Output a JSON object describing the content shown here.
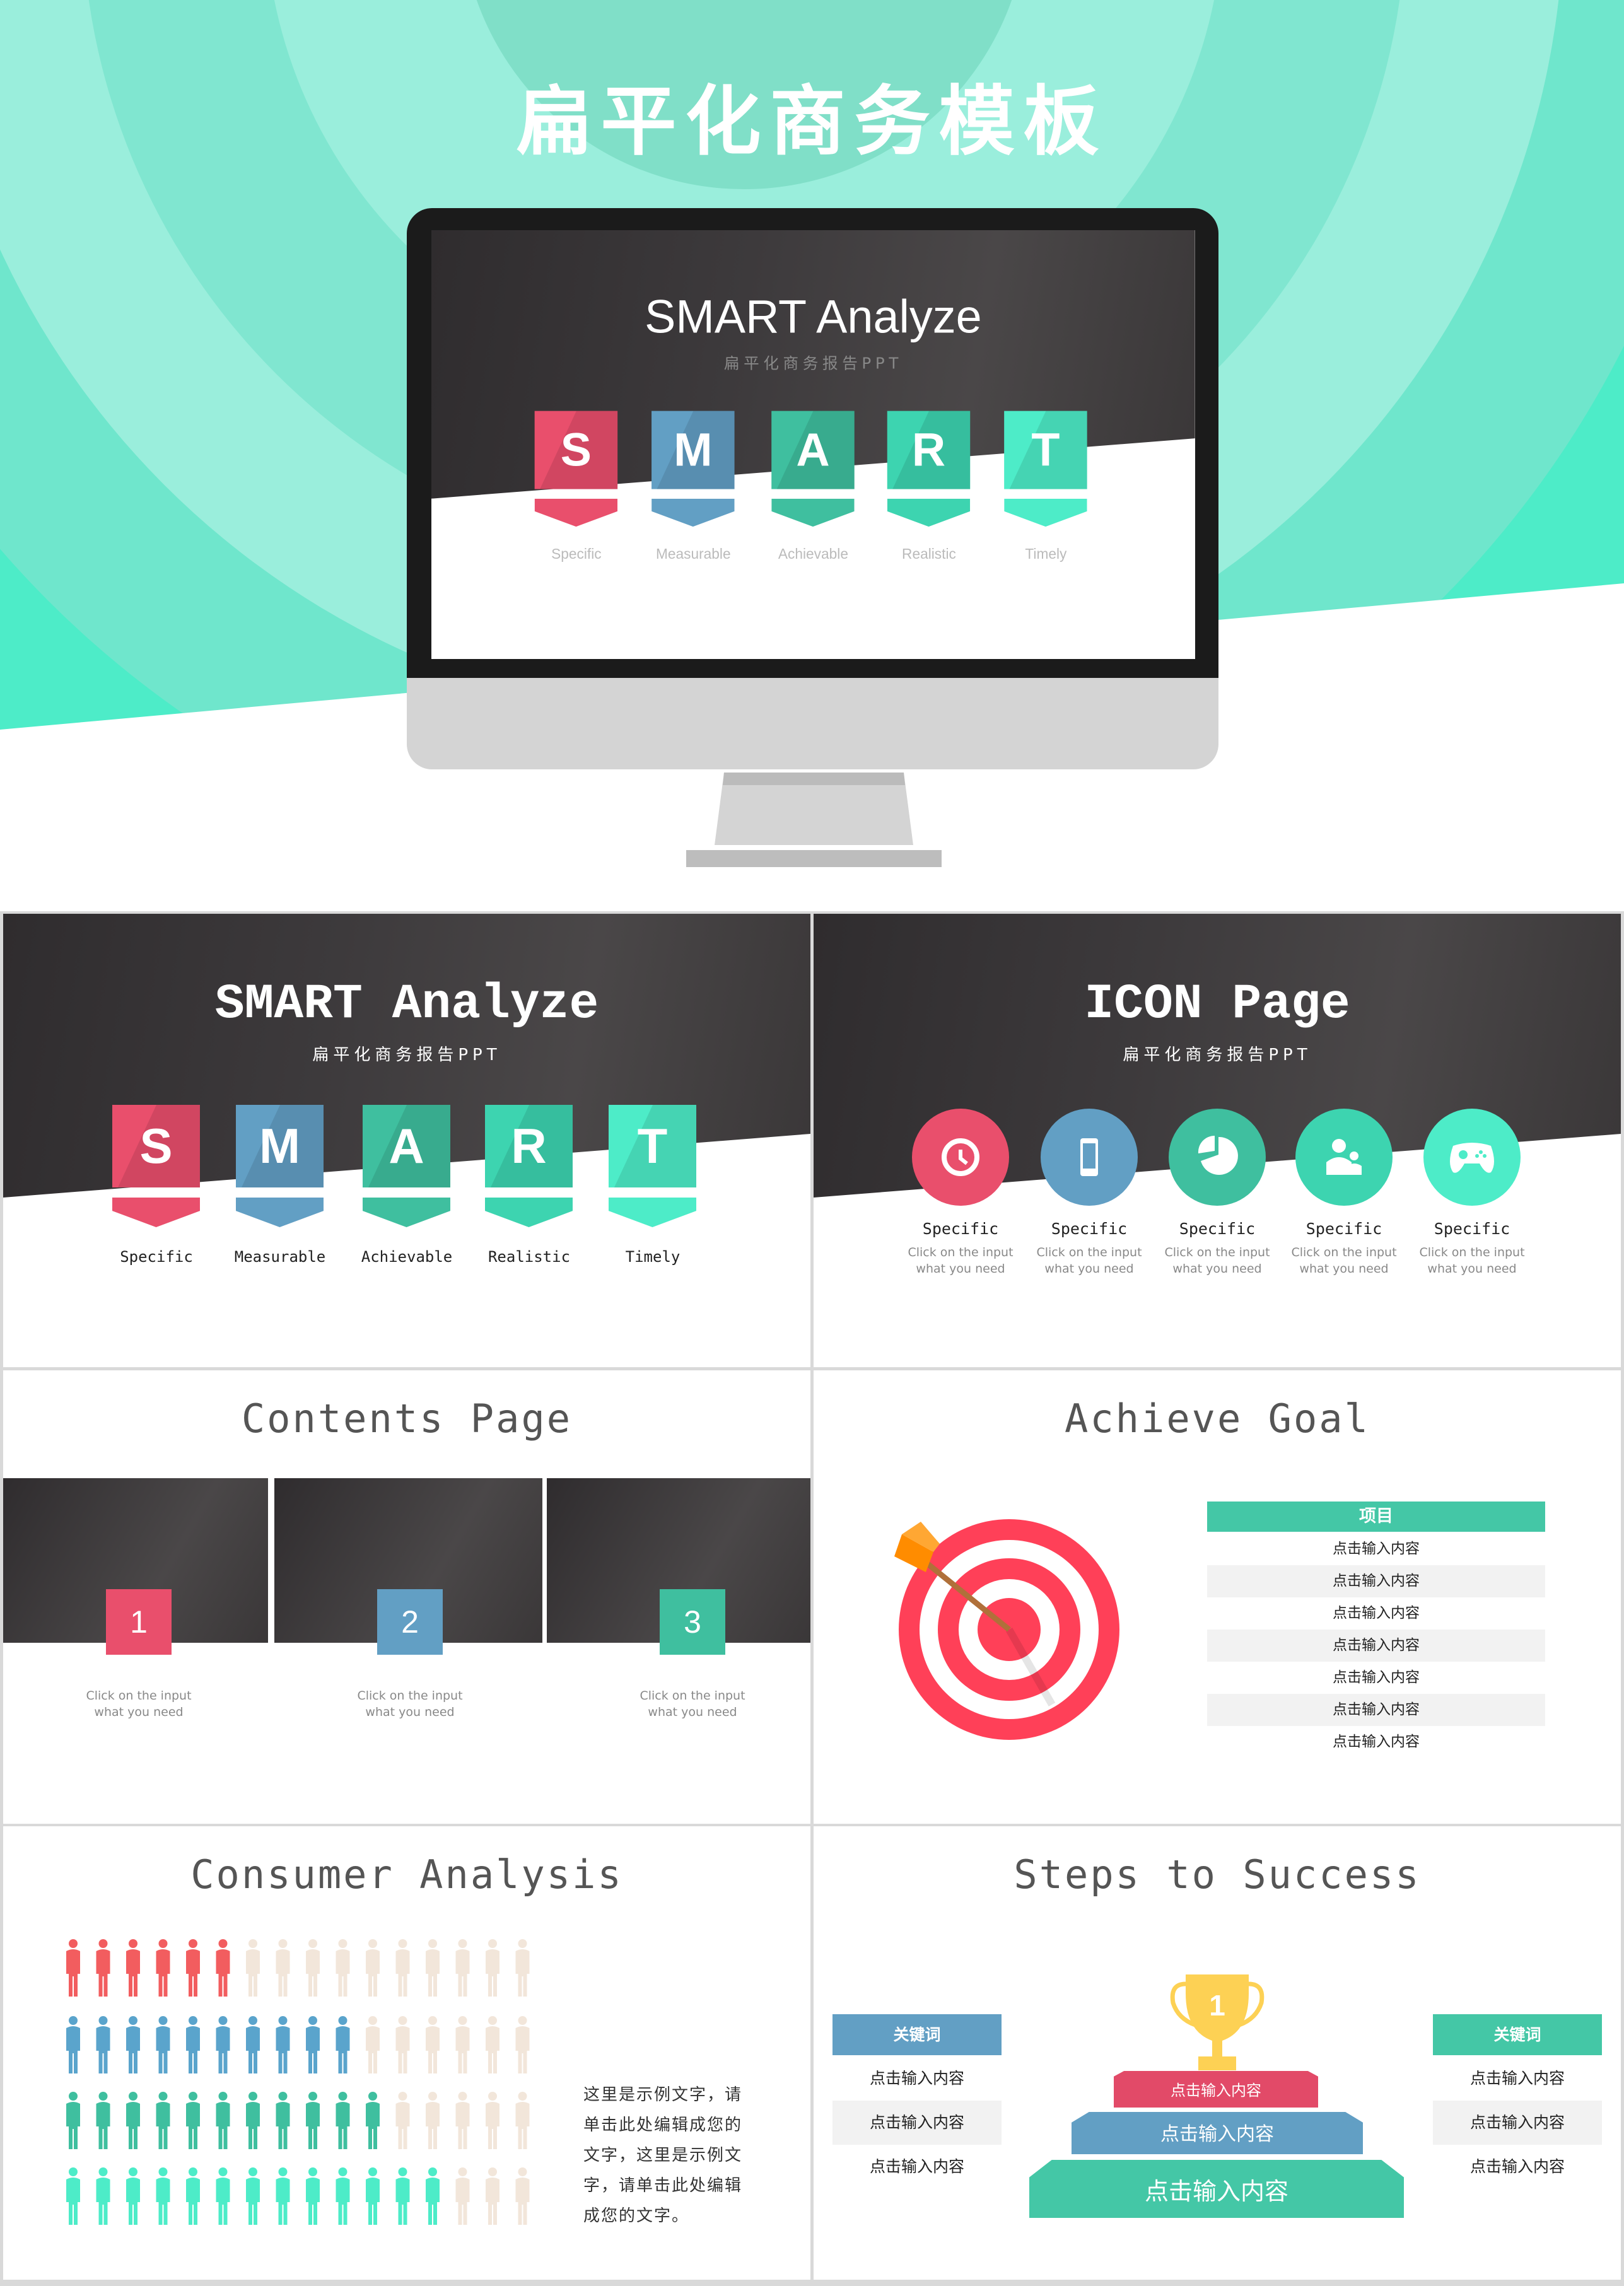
{
  "hero": {
    "title": "扁平化商务模板"
  },
  "colors": {
    "red": "#e94f6c",
    "blue": "#629fc4",
    "green": "#3fbf9f",
    "teal": "#3dd4b0",
    "mint": "#4decc8",
    "people_empty": "#f2e6da",
    "people_red": "#f25d5f",
    "people_blue": "#5aa4cc",
    "target_red": "#ff4058",
    "trophy": "#fdd154"
  },
  "monitor_screen": {
    "title": "SMART Analyze",
    "subtitle": "扁平化商务报告PPT",
    "letters": [
      {
        "letter": "S",
        "label": "Specific"
      },
      {
        "letter": "M",
        "label": "Measurable"
      },
      {
        "letter": "A",
        "label": "Achievable"
      },
      {
        "letter": "R",
        "label": "Realistic"
      },
      {
        "letter": "T",
        "label": "Timely"
      }
    ]
  },
  "smart": {
    "title": "SMART Analyze",
    "subtitle": "扁平化商务报告PPT",
    "letters": [
      {
        "letter": "S",
        "label": "Specific"
      },
      {
        "letter": "M",
        "label": "Measurable"
      },
      {
        "letter": "A",
        "label": "Achievable"
      },
      {
        "letter": "R",
        "label": "Realistic"
      },
      {
        "letter": "T",
        "label": "Timely"
      }
    ]
  },
  "icon_page": {
    "title": "ICON Page",
    "subtitle": "扁平化商务报告PPT",
    "items": [
      {
        "icon": "clock-icon",
        "label": "Specific",
        "line1": "Click on the input",
        "line2": "what you need"
      },
      {
        "icon": "smartphone-icon",
        "label": "Specific",
        "line1": "Click on the input",
        "line2": "what you need"
      },
      {
        "icon": "pie-chart-icon",
        "label": "Specific",
        "line1": "Click on the input",
        "line2": "what you need"
      },
      {
        "icon": "users-icon",
        "label": "Specific",
        "line1": "Click on the input",
        "line2": "what you need"
      },
      {
        "icon": "gamepad-icon",
        "label": "Specific",
        "line1": "Click on the input",
        "line2": "what you need"
      }
    ]
  },
  "contents": {
    "title": "Contents Page",
    "items": [
      {
        "number": "1",
        "line1": "Click on the input",
        "line2": "what you need"
      },
      {
        "number": "2",
        "line1": "Click on the input",
        "line2": "what you need"
      },
      {
        "number": "3",
        "line1": "Click on the input",
        "line2": "what you need"
      }
    ]
  },
  "achieve": {
    "title": "Achieve Goal",
    "table_header": "项目",
    "rows": [
      "点击输入内容",
      "点击输入内容",
      "点击输入内容",
      "点击输入内容",
      "点击输入内容",
      "点击输入内容",
      "点击输入内容"
    ]
  },
  "consumer": {
    "title": "Consumer Analysis",
    "people_per_row": 16,
    "rows": [
      {
        "filled": 6,
        "color": "red"
      },
      {
        "filled": 10,
        "color": "blue"
      },
      {
        "filled": 11,
        "color": "green"
      },
      {
        "filled": 13,
        "color": "mint"
      }
    ],
    "text_lines": [
      "这里是示例文字，请",
      "单击此处编辑成您的",
      "文字，这里是示例文",
      "字，请单击此处编辑",
      "成您的文字。"
    ]
  },
  "steps": {
    "title": "Steps to Success",
    "trophy_number": "1",
    "left": {
      "header": "关键词",
      "items": [
        "点击输入内容",
        "点击输入内容",
        "点击输入内容"
      ]
    },
    "right": {
      "header": "关键词",
      "items": [
        "点击输入内容",
        "点击输入内容",
        "点击输入内容"
      ]
    },
    "podium": [
      "点击输入内容",
      "点击输入内容",
      "点击输入内容"
    ]
  }
}
